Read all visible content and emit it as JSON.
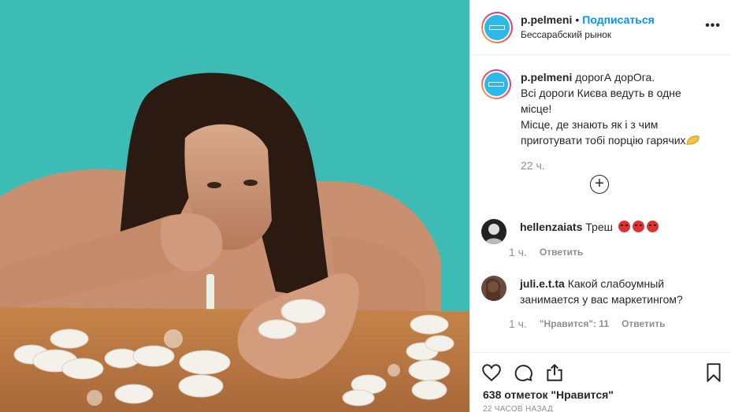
{
  "header": {
    "username": "p.pelmeni",
    "separator": "•",
    "follow_label": "Подписаться",
    "location": "Бессарабский рынок",
    "more_icon": "ellipsis-icon"
  },
  "caption": {
    "username": "p.pelmeni",
    "lines": [
      "дорогА дорОга.",
      "Всі дороги Києва ведуть в одне",
      "місце!",
      "Місце, де знають як і з чим",
      "приготувати тобі порцію гарячих"
    ],
    "emoji": "dumpling-emoji",
    "time": "22 ч."
  },
  "load_more_icon": "plus-circle-icon",
  "comments": [
    {
      "username": "hellenzaiats",
      "text": "Треш",
      "emojis": [
        "angry-face-emoji",
        "angry-face-emoji",
        "angry-face-emoji"
      ],
      "time": "1 ч.",
      "reply_label": "Ответить"
    },
    {
      "username": "juli.e.t.ta",
      "text_line1": "Какой слабоумный",
      "text_line2": "занимается у вас маркетингом?",
      "time": "1 ч.",
      "likes_label": "\"Нравится\": 11",
      "reply_label": "Ответить"
    }
  ],
  "actions": {
    "like_icon": "heart-icon",
    "comment_icon": "comment-icon",
    "share_icon": "share-icon",
    "save_icon": "bookmark-icon"
  },
  "likes_text": "638 отметок \"Нравится\"",
  "posted_ago": "22 ЧАСОВ НАЗАД",
  "colors": {
    "accent": "#0095f6",
    "photo_background": "#3dbcb5",
    "table": "#c98a52",
    "muted_text": "#8e8e8e"
  }
}
